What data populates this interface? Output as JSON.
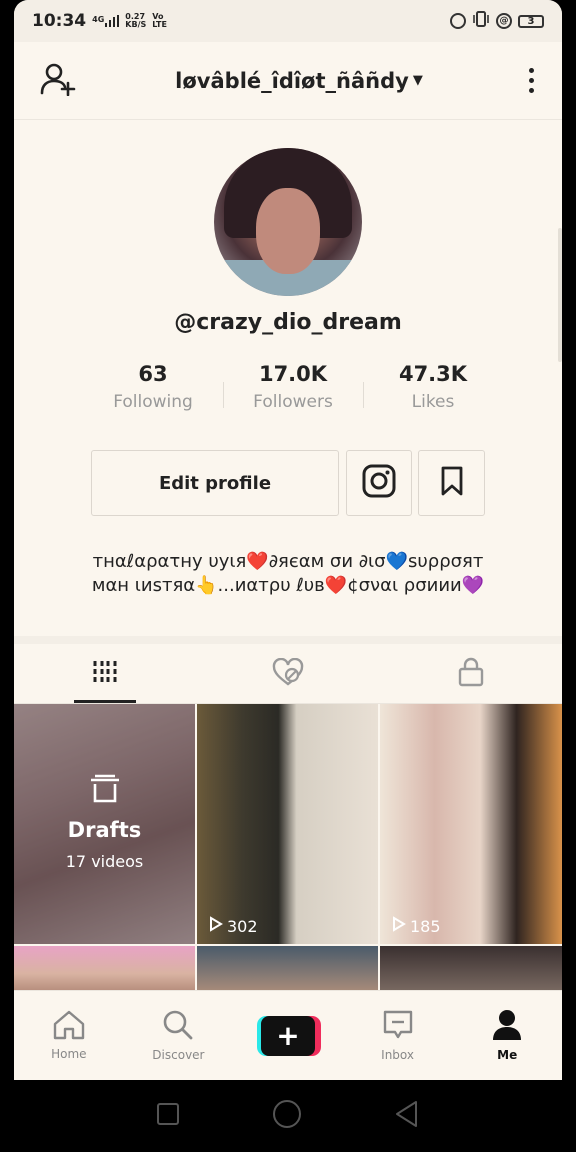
{
  "status_bar": {
    "time": "10:34",
    "network_type": "4G",
    "speed": "0.27",
    "speed_unit": "KB/S",
    "carrier": "Vo LTE",
    "battery": "3"
  },
  "header": {
    "username": "løvâblé_îdîøt_ñâñdy",
    "add_user_icon": "add-user-icon",
    "menu_icon": "more-vertical-icon"
  },
  "profile": {
    "handle": "@crazy_dio_dream",
    "stats": [
      {
        "value": "63",
        "label": "Following"
      },
      {
        "value": "17.0K",
        "label": "Followers"
      },
      {
        "value": "47.3K",
        "label": "Likes"
      }
    ],
    "edit_profile_label": "Edit profile",
    "bio_lines": [
      "тнαℓαρατну υуιя❤️∂яєαм σи ∂ισ💙ѕυρρσят",
      "мαн ιиѕтяα👆...иαтρυ ℓυв❤️¢σναι ρσиии💜"
    ]
  },
  "tabs": [
    {
      "icon": "grid-icon",
      "active": true
    },
    {
      "icon": "liked-hidden-icon",
      "active": false
    },
    {
      "icon": "lock-icon",
      "active": false
    }
  ],
  "videos": {
    "drafts": {
      "title": "Drafts",
      "count_label": "17 videos"
    },
    "items": [
      {
        "views": "302"
      },
      {
        "views": "185"
      }
    ]
  },
  "bottom_nav": [
    {
      "label": "Home",
      "icon": "home-icon"
    },
    {
      "label": "Discover",
      "icon": "search-icon"
    },
    {
      "label": "",
      "icon": "plus-icon"
    },
    {
      "label": "Inbox",
      "icon": "inbox-icon"
    },
    {
      "label": "Me",
      "icon": "person-icon"
    }
  ],
  "colors": {
    "background": "#fbf6ee",
    "text": "#222222",
    "muted": "#999999",
    "create_cyan": "#2ae8e8",
    "create_pink": "#f02d5c",
    "heart_red": "#e0245e"
  }
}
